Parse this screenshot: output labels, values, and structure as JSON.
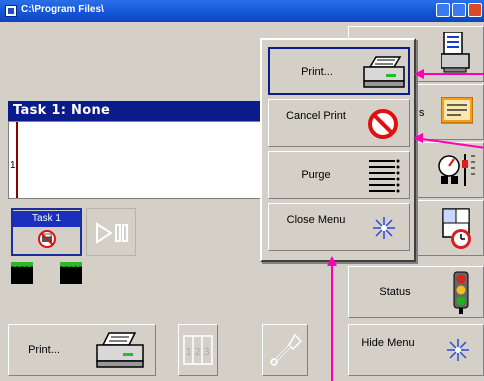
{
  "window": {
    "title": "C:\\Program Files\\"
  },
  "task_panel": {
    "header": "Task 1: None",
    "row_number": "1"
  },
  "task_tile": {
    "label": "Task 1",
    "icon": "no-print-icon"
  },
  "ink_indicators": [
    "ink-cartridge-icon",
    "ink-cartridge-icon"
  ],
  "popup_menu": {
    "items": [
      {
        "label": "Print...",
        "icon": "printer-icon"
      },
      {
        "label": "Cancel Print",
        "icon": "cancel-icon"
      },
      {
        "label": "Purge",
        "icon": "purge-icon"
      },
      {
        "label": "Close Menu",
        "icon": "asterisk-icon"
      }
    ]
  },
  "right_column": {
    "status_label": "Status",
    "hide_menu_label": "Hide Menu",
    "partial_letter": "s"
  },
  "bottom_bar": {
    "print_label": "Print..."
  },
  "colors": {
    "callout": "#ff00b4",
    "header_bg": "#0a1c8c",
    "panel_bg": "#d4d0c8"
  }
}
